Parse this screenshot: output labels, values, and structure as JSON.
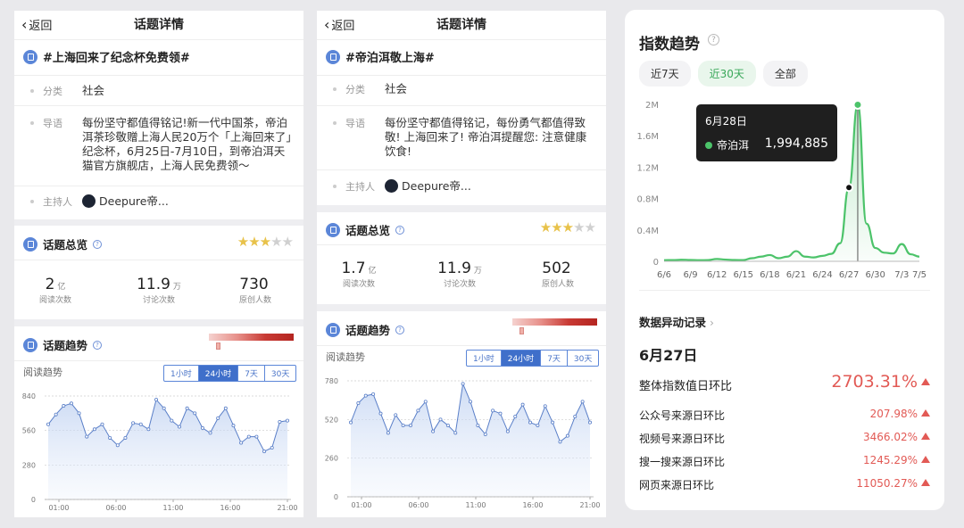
{
  "panel1": {
    "back_label": "返回",
    "title": "话题详情",
    "topic": "#上海回来了纪念杯免费领#",
    "category_label": "分类",
    "category_value": "社会",
    "guide_label": "导语",
    "guide_value": "每份坚守都值得铭记!新一代中国茶，帝泊洱茶珍敬赠上海人民20万个「上海回来了」纪念杯，6月25日-7月10日，到帝泊洱天猫官方旗舰店，上海人民免费领～",
    "host_label": "主持人",
    "host_value": "Deepure帝...",
    "overview_title": "话题总览",
    "stars_on": 3,
    "stats": [
      {
        "num": "2",
        "unit": "亿",
        "cap": "阅读次数"
      },
      {
        "num": "11.9",
        "unit": "万",
        "cap": "讨论次数"
      },
      {
        "num": "730",
        "unit": "",
        "cap": "原创人数"
      }
    ],
    "trend_title": "话题趋势",
    "trend_sub": "阅读趋势",
    "segments": [
      "1小时",
      "24小时",
      "7天",
      "30天"
    ],
    "segment_active": 1,
    "chart_data": {
      "type": "area",
      "x": [
        "01:00",
        "06:00",
        "11:00",
        "16:00",
        "21:00"
      ],
      "yticks": [
        "0",
        "280",
        "560",
        "840"
      ],
      "ylim": [
        0,
        840
      ],
      "values": [
        610,
        690,
        760,
        780,
        700,
        510,
        570,
        610,
        500,
        440,
        500,
        620,
        610,
        570,
        810,
        740,
        640,
        590,
        740,
        700,
        580,
        540,
        660,
        740,
        600,
        460,
        510,
        510,
        390,
        420,
        630,
        640
      ]
    }
  },
  "panel2": {
    "back_label": "返回",
    "title": "话题详情",
    "topic": "#帝泊洱敬上海#",
    "category_label": "分类",
    "category_value": "社会",
    "guide_label": "导语",
    "guide_value": "每份坚守都值得铭记，每份勇气都值得致敬! 上海回来了! 帝泊洱提醒您: 注意健康饮食!",
    "host_label": "主持人",
    "host_value": "Deepure帝...",
    "overview_title": "话题总览",
    "stars_on": 3,
    "stats": [
      {
        "num": "1.7",
        "unit": "亿",
        "cap": "阅读次数"
      },
      {
        "num": "11.9",
        "unit": "万",
        "cap": "讨论次数"
      },
      {
        "num": "502",
        "unit": "",
        "cap": "原创人数"
      }
    ],
    "trend_title": "话题趋势",
    "trend_sub": "阅读趋势",
    "segments": [
      "1小时",
      "24小时",
      "7天",
      "30天"
    ],
    "segment_active": 1,
    "chart_data": {
      "type": "area",
      "x": [
        "01:00",
        "06:00",
        "11:00",
        "16:00",
        "21:00"
      ],
      "yticks": [
        "0",
        "260",
        "520",
        "780"
      ],
      "ylim": [
        0,
        780
      ],
      "values": [
        500,
        630,
        680,
        690,
        560,
        430,
        550,
        480,
        480,
        580,
        640,
        440,
        520,
        480,
        430,
        760,
        640,
        480,
        420,
        580,
        560,
        440,
        540,
        620,
        500,
        480,
        610,
        500,
        370,
        410,
        540,
        640,
        500
      ]
    }
  },
  "panel3": {
    "title": "指数趋势",
    "chips": [
      "近7天",
      "近30天",
      "全部"
    ],
    "chip_active": 1,
    "tooltip_date": "6月28日",
    "tooltip_series": "帝泊洱",
    "tooltip_value": "1,994,885",
    "chart_data": {
      "type": "area",
      "x": [
        "6/6",
        "6/7",
        "6/8",
        "6/9",
        "6/10",
        "6/11",
        "6/12",
        "6/13",
        "6/14",
        "6/15",
        "6/16",
        "6/17",
        "6/18",
        "6/19",
        "6/20",
        "6/21",
        "6/22",
        "6/23",
        "6/24",
        "6/25",
        "6/26",
        "6/27",
        "6/28",
        "6/29",
        "6/30",
        "7/1",
        "7/2",
        "7/3",
        "7/4",
        "7/5"
      ],
      "xticks": [
        "6/6",
        "6/9",
        "6/12",
        "6/15",
        "6/18",
        "6/21",
        "6/24",
        "6/27",
        "6/30",
        "7/3",
        "7/5"
      ],
      "yticks": [
        "0",
        "0.4M",
        "0.8M",
        "1.2M",
        "1.6M",
        "2M"
      ],
      "ylim": [
        0,
        2000000
      ],
      "series": [
        {
          "name": "帝泊洱",
          "color": "#4cc36a",
          "values": [
            15000,
            16000,
            20000,
            18000,
            14000,
            16000,
            30000,
            22000,
            17000,
            16000,
            40000,
            60000,
            80000,
            40000,
            60000,
            130000,
            60000,
            50000,
            70000,
            95000,
            230000,
            940000,
            1994885,
            480000,
            170000,
            110000,
            100000,
            220000,
            90000,
            60000
          ]
        }
      ],
      "highlight_index": 22,
      "marker_index": 21
    },
    "anomaly_title": "数据异动记录",
    "anomaly_date": "6月27日",
    "rows": [
      {
        "label": "整体指数值日环比",
        "value": "2703.31%"
      },
      {
        "label": "公众号来源日环比",
        "value": "207.98%"
      },
      {
        "label": "视频号来源日环比",
        "value": "3466.02%"
      },
      {
        "label": "搜一搜来源日环比",
        "value": "1245.29%"
      },
      {
        "label": "网页来源日环比",
        "value": "11050.27%"
      }
    ]
  }
}
